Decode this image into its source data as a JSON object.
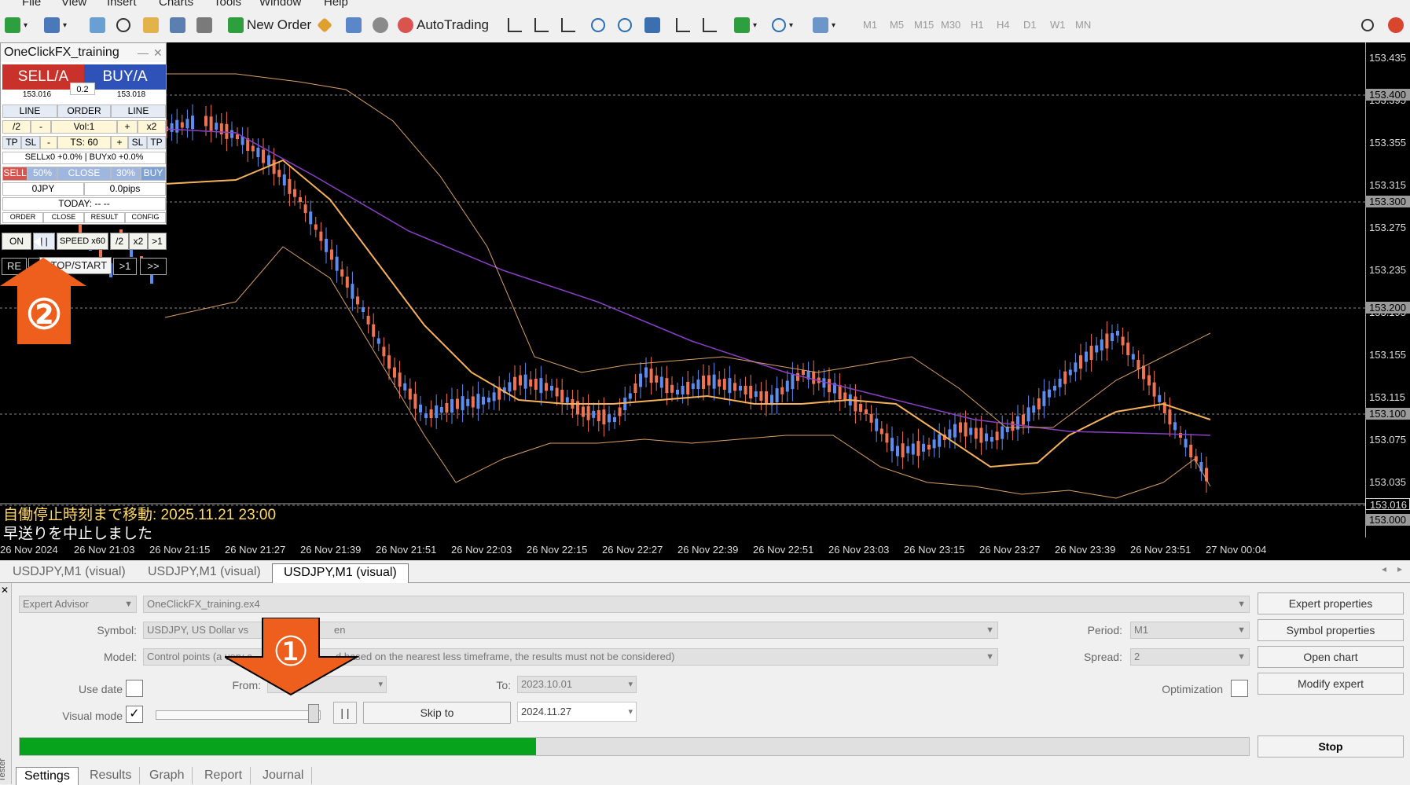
{
  "menu": {
    "items": [
      "File",
      "View",
      "Insert",
      "Charts",
      "Tools",
      "Window",
      "Help"
    ]
  },
  "toolbar": {
    "new_order": "New Order",
    "autotrading": "AutoTrading",
    "timeframes": [
      "M1",
      "M5",
      "M15",
      "M30",
      "H1",
      "H4",
      "D1",
      "W1",
      "MN"
    ]
  },
  "panel": {
    "title": "OneClickFX_training",
    "sell": "SELL/A",
    "buy": "BUY/A",
    "lot": "0.2",
    "sell_price": "153.016",
    "buy_price": "153.018",
    "row_line_order": [
      "LINE",
      "ORDER",
      "LINE"
    ],
    "row_vol": [
      "/2",
      "-",
      "Vol:1",
      "+",
      "x2"
    ],
    "row_ts": [
      "TP",
      "SL",
      "-",
      "TS: 60",
      "+",
      "SL",
      "TP"
    ],
    "position_info": "SELLx0 +0.0% | BUYx0 +0.0%",
    "row_close": [
      "SELL",
      "50%",
      "CLOSE",
      "30%",
      "BUY"
    ],
    "pl_jpy": "0JPY",
    "pl_pips": "0.0pips",
    "today": "TODAY: -- --",
    "bottom_buttons": [
      "ORDER",
      "CLOSE",
      "RESULT",
      "CONFIG"
    ]
  },
  "controller": {
    "row1": [
      "ON",
      "| |",
      "SPEED x60",
      "/2",
      "x2",
      ">1"
    ],
    "row2": [
      "RE",
      "",
      ">1",
      ">>"
    ],
    "tooltip": "STOP/START"
  },
  "markers": {
    "m1": "①",
    "m2": "②"
  },
  "chart": {
    "status_line1": "自働停止時刻まで移動: 2025.11.21 23:00",
    "status_line2": "早送りを中止しました",
    "price_labels": [
      "153.435",
      "153.395",
      "153.355",
      "153.315",
      "153.275",
      "153.235",
      "153.195",
      "153.155",
      "153.115",
      "153.075",
      "153.035"
    ],
    "price_boxes": [
      "153.400",
      "153.300",
      "153.200",
      "153.100",
      "153.016",
      "153.000"
    ],
    "time_labels": [
      "26 Nov 2024",
      "26 Nov 21:03",
      "26 Nov 21:15",
      "26 Nov 21:27",
      "26 Nov 21:39",
      "26 Nov 21:51",
      "26 Nov 22:03",
      "26 Nov 22:15",
      "26 Nov 22:27",
      "26 Nov 22:39",
      "26 Nov 22:51",
      "26 Nov 23:03",
      "26 Nov 23:15",
      "26 Nov 23:27",
      "26 Nov 23:39",
      "26 Nov 23:51",
      "27 Nov 00:04"
    ],
    "colors": {
      "bull": "#5b8cf0",
      "bear": "#f0724f",
      "ma_fast": "#f5b25a",
      "ma_slow": "#8a3fc7",
      "bands": "#d9a066"
    }
  },
  "chart_tabs": [
    "USDJPY,M1 (visual)",
    "USDJPY,M1 (visual)",
    "USDJPY,M1 (visual)"
  ],
  "tester": {
    "type": "Expert Advisor",
    "expert": "OneClickFX_training.ex4",
    "symbol_label": "Symbol:",
    "symbol_value": "USDJPY, US Dollar vs",
    "symbol_value_tail": "en",
    "model_label": "Model:",
    "model_value": "Control points (a very c",
    "model_value_tail": "d based on the nearest less timeframe, the results must not be considered)",
    "use_date": "Use date",
    "from_label": "From:",
    "to_label": "To:",
    "to_value": "2023.10.01",
    "visual_mode": "Visual mode",
    "pause": "| |",
    "skip_to": "Skip to",
    "skip_date": "2024.11.27",
    "period_label": "Period:",
    "period_value": "M1",
    "spread_label": "Spread:",
    "spread_value": "2",
    "optimization": "Optimization",
    "expert_properties": "Expert properties",
    "symbol_properties": "Symbol properties",
    "open_chart": "Open chart",
    "modify_expert": "Modify expert",
    "stop": "Stop",
    "progress": 0.42,
    "side_label": "Tester"
  },
  "bottom_tabs": [
    "Settings",
    "Results",
    "Graph",
    "Report",
    "Journal"
  ]
}
